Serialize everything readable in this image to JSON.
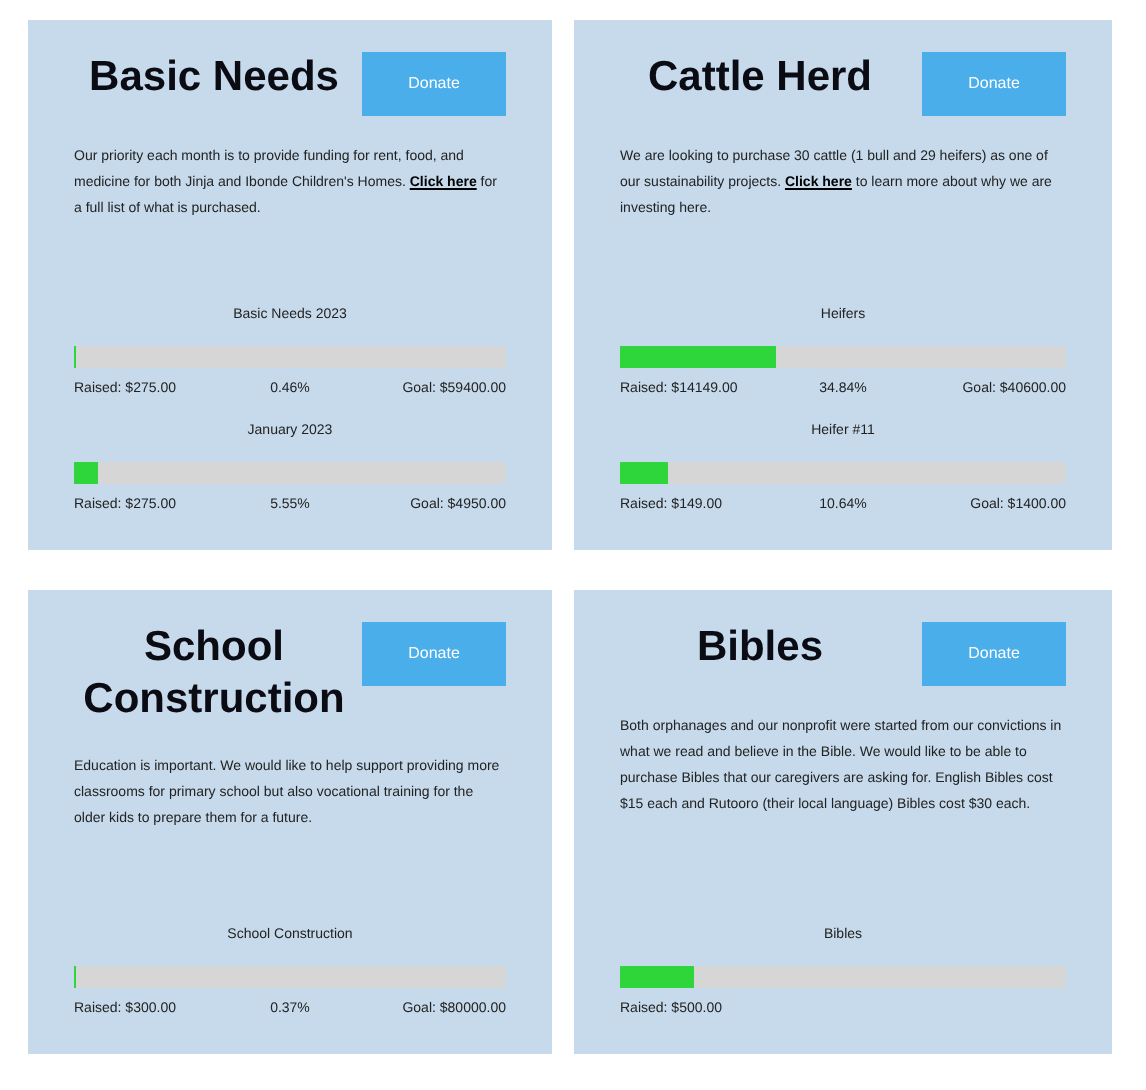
{
  "cards": [
    {
      "title": "Basic Needs",
      "button": "Donate",
      "description": [
        {
          "kind": "text",
          "text": "Our priority each month is to provide funding for rent, food, and medicine for both Jinja and Ibonde Children's Homes.  "
        },
        {
          "kind": "link",
          "text": "Click here"
        },
        {
          "kind": "text",
          "text": " for a full list of what is purchased."
        }
      ],
      "campaigns": [
        {
          "name": "Basic Needs 2023",
          "level": 0.0046,
          "raised": "Raised: $275.00",
          "percent": "0.46%",
          "goal": "Goal: $59400.00"
        },
        {
          "name": "January 2023",
          "level": 0.0555,
          "raised": "Raised: $275.00",
          "percent": "5.55%",
          "goal": "Goal: $4950.00"
        }
      ]
    },
    {
      "title": "Cattle Herd",
      "button": "Donate",
      "description": [
        {
          "kind": "text",
          "text": "We are looking to purchase 30 cattle (1 bull and 29 heifers) as one of our sustainability projects. "
        },
        {
          "kind": "link",
          "text": "Click here"
        },
        {
          "kind": "text",
          "text": " to learn more about why we are investing here."
        }
      ],
      "campaigns": [
        {
          "name": "Heifers",
          "level": 0.3484,
          "raised": "Raised: $14149.00",
          "percent": "34.84%",
          "goal": "Goal: $40600.00"
        },
        {
          "name": "Heifer #11",
          "level": 0.1064,
          "raised": "Raised: $149.00",
          "percent": "10.64%",
          "goal": "Goal: $1400.00"
        }
      ]
    },
    {
      "title": "School Construction",
      "button": "Donate",
      "description": [
        {
          "kind": "text",
          "text": "Education is important. We would like to help support providing more classrooms for primary school but also vocational training for the older kids to prepare them for a future."
        }
      ],
      "campaigns": [
        {
          "name": "School Construction",
          "level": 0.0037,
          "raised": "Raised: $300.00",
          "percent": "0.37%",
          "goal": "Goal: $80000.00"
        }
      ]
    },
    {
      "title": "Bibles",
      "button": "Donate",
      "description": [
        {
          "kind": "text",
          "text": "Both orphanages and our nonprofit were started from our convictions in what we read and believe in the Bible. We would like to be able to purchase Bibles that our caregivers are asking for. English Bibles cost $15 each and Rutooro (their local language) Bibles cost $30 each."
        }
      ],
      "campaigns": [
        {
          "name": "Bibles",
          "level": 0.165,
          "raised": "Raised: $500.00"
        }
      ]
    }
  ]
}
